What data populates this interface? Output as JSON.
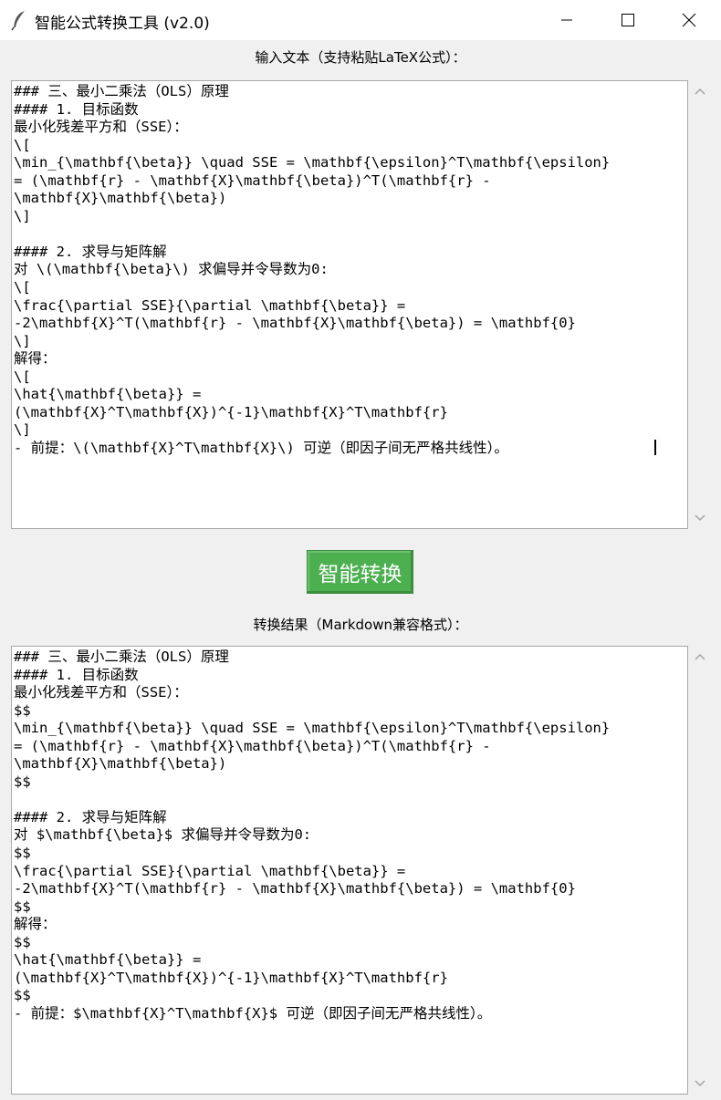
{
  "window": {
    "title": "智能公式转换工具 (v2.0)",
    "icon": "feather-icon",
    "controls": [
      "minimize-icon",
      "maximize-icon",
      "close-icon"
    ]
  },
  "input_section": {
    "label": "输入文本（支持粘贴LaTeX公式）：",
    "text": "### 三、最小二乘法（OLS）原理\n#### 1. 目标函数\n最小化残差平方和（SSE）：\n\\[\n\\min_{\\mathbf{\\beta}} \\quad SSE = \\mathbf{\\epsilon}^T\\mathbf{\\epsilon}\n= (\\mathbf{r} - \\mathbf{X}\\mathbf{\\beta})^T(\\mathbf{r} -\n\\mathbf{X}\\mathbf{\\beta})\n\\]\n\n#### 2. 求导与矩阵解\n对 \\(\\mathbf{\\beta}\\) 求偏导并令导数为0:\n\\[\n\\frac{\\partial SSE}{\\partial \\mathbf{\\beta}} =\n-2\\mathbf{X}^T(\\mathbf{r} - \\mathbf{X}\\mathbf{\\beta}) = \\mathbf{0}\n\\]\n解得：\n\\[\n\\hat{\\mathbf{\\beta}} =\n(\\mathbf{X}^T\\mathbf{X})^{-1}\\mathbf{X}^T\\mathbf{r}\n\\]\n- 前提：\\(\\mathbf{X}^T\\mathbf{X}\\) 可逆（即因子间无严格共线性）。"
  },
  "convert_button": {
    "label": "智能转换"
  },
  "output_section": {
    "label": "转换结果（Markdown兼容格式）：",
    "text": "### 三、最小二乘法（OLS）原理\n#### 1. 目标函数\n最小化残差平方和（SSE）：\n$$\n\\min_{\\mathbf{\\beta}} \\quad SSE = \\mathbf{\\epsilon}^T\\mathbf{\\epsilon}\n= (\\mathbf{r} - \\mathbf{X}\\mathbf{\\beta})^T(\\mathbf{r} -\n\\mathbf{X}\\mathbf{\\beta})\n$$\n\n#### 2. 求导与矩阵解\n对 $\\mathbf{\\beta}$ 求偏导并令导数为0:\n$$\n\\frac{\\partial SSE}{\\partial \\mathbf{\\beta}} =\n-2\\mathbf{X}^T(\\mathbf{r} - \\mathbf{X}\\mathbf{\\beta}) = \\mathbf{0}\n$$\n解得：\n$$\n\\hat{\\mathbf{\\beta}} =\n(\\mathbf{X}^T\\mathbf{X})^{-1}\\mathbf{X}^T\\mathbf{r}\n$$\n- 前提：$\\mathbf{X}^T\\mathbf{X}$ 可逆（即因子间无严格共线性）。"
  },
  "colors": {
    "button_bg": "#4caf50",
    "window_bg": "#f0f0f0"
  }
}
